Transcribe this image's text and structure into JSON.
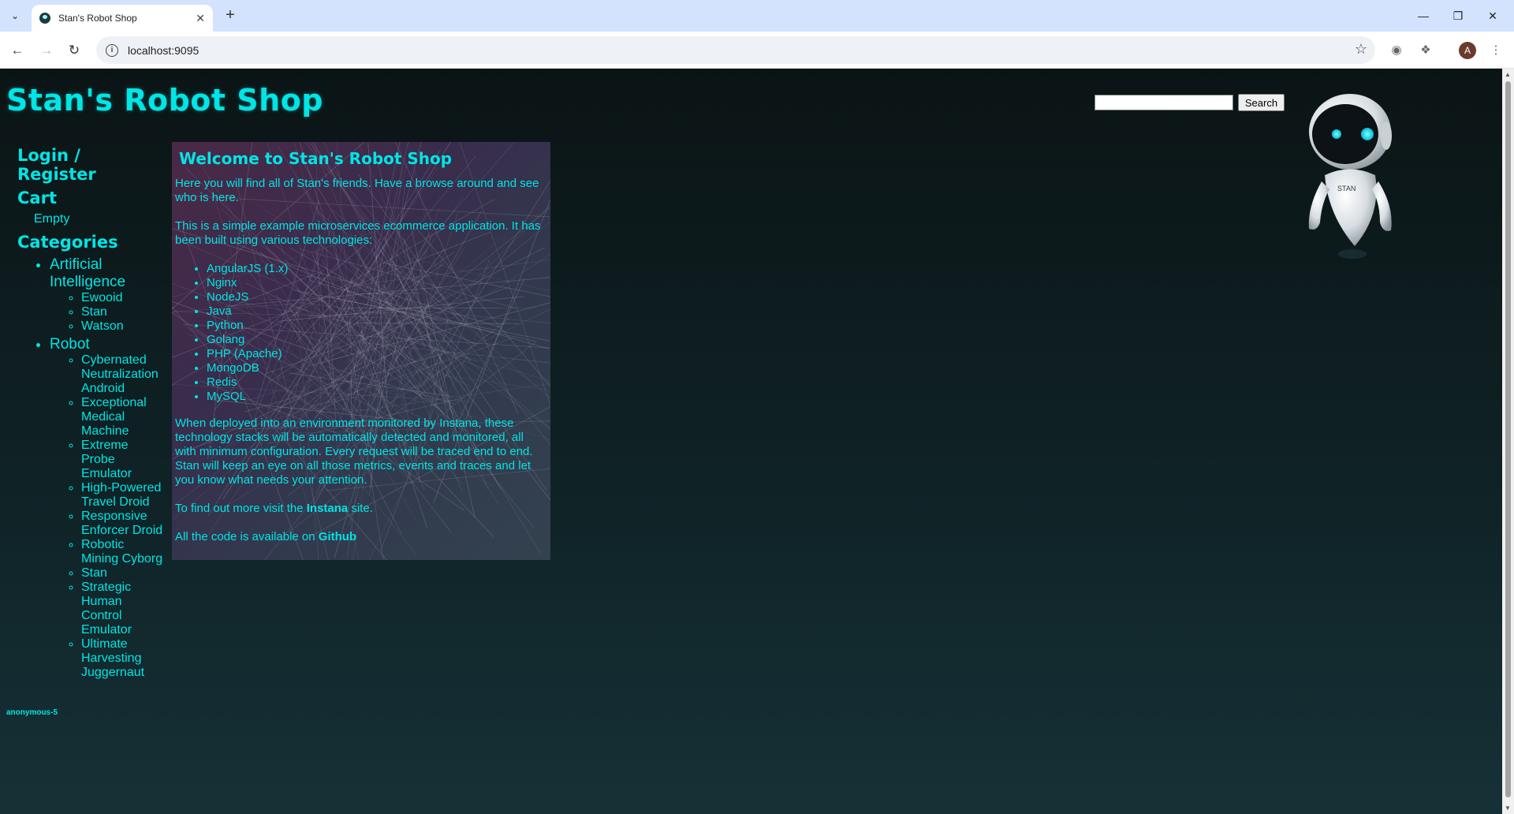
{
  "browser": {
    "tab_title": "Stan's Robot Shop",
    "url": "localhost:9095",
    "profile_initial": "A"
  },
  "site": {
    "title": "Stan's Robot Shop",
    "search_button": "Search",
    "search_value": "",
    "robot_badge": "STAN"
  },
  "sidebar": {
    "login": "Login / Register",
    "cart": "Cart",
    "cart_status": "Empty",
    "categories_heading": "Categories",
    "categories": [
      {
        "name": "Artificial Intelligence",
        "items": [
          "Ewooid",
          "Stan",
          "Watson"
        ]
      },
      {
        "name": "Robot",
        "items": [
          "Cybernated Neutralization Android",
          "Exceptional Medical Machine",
          "Extreme Probe Emulator",
          "High-Powered Travel Droid",
          "Responsive Enforcer Droid",
          "Robotic Mining Cyborg",
          "Stan",
          "Strategic Human Control Emulator",
          "Ultimate Harvesting Juggernaut"
        ]
      }
    ],
    "user_id": "anonymous-5"
  },
  "welcome": {
    "heading": "Welcome to Stan's Robot Shop",
    "p1": "Here you will find all of Stan's friends. Have a browse around and see who is here.",
    "p2": "This is a simple example microservices ecommerce application. It has been built using various technologies:",
    "technologies": [
      "AngularJS (1.x)",
      "Nginx",
      "NodeJS",
      "Java",
      "Python",
      "Golang",
      "PHP (Apache)",
      "MongoDB",
      "Redis",
      "MySQL"
    ],
    "p3": "When deployed into an environment monitored by Instana, these technology stacks will be automatically detected and monitored, all with minimum configuration. Every request will be traced end to end. Stan will keep an eye on all those metrics, events and traces and let you know what needs your attention.",
    "p4_prefix": "To find out more visit the ",
    "p4_link": "Instana",
    "p4_suffix": " site.",
    "p5_prefix": "All the code is available on ",
    "p5_link": "Github"
  },
  "colors": {
    "accent": "#00e5e5",
    "background": "#0f2226",
    "panel": "#3a2c4c"
  }
}
